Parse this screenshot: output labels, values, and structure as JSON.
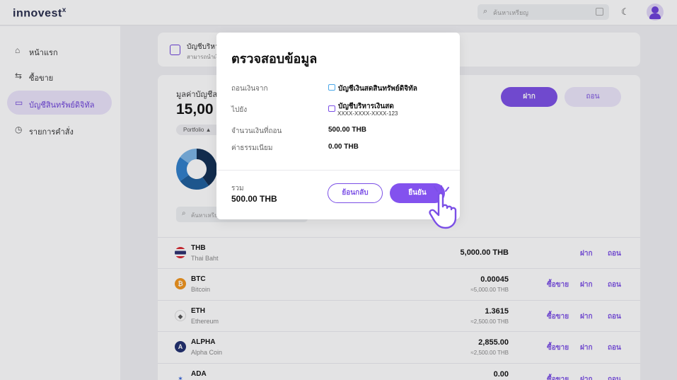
{
  "header": {
    "logo": "innovest",
    "logo_mark": "x",
    "search_placeholder": "ค้นหาเหรียญ"
  },
  "sidebar": {
    "items": [
      {
        "label": "หน้าแรก",
        "icon": "home-icon"
      },
      {
        "label": "ซื้อขาย",
        "icon": "swap-icon"
      },
      {
        "label": "บัญชีสินทรัพย์ดิจิทัล",
        "icon": "wallet-icon",
        "active": true
      },
      {
        "label": "รายการคำสั่ง",
        "icon": "history-icon"
      }
    ]
  },
  "account_card": {
    "title": "บัญชีบริหา",
    "subtitle": "สามารถนำเงิน"
  },
  "portfolio": {
    "label": "มูลค่าบัญชีส",
    "value": "15,00",
    "filter": "Portfolio ▲",
    "deposit_label": "ฝาก",
    "withdraw_label": "ถอน",
    "search_placeholder": "ค้นหาเหรีย",
    "donut": [
      {
        "color": "#0f2d52",
        "value": 40
      },
      {
        "color": "#1c5d9c",
        "value": 25
      },
      {
        "color": "#2f7fcb",
        "value": 20
      },
      {
        "color": "#7bb5e6",
        "value": 15
      }
    ]
  },
  "assets": [
    {
      "symbol": "THB",
      "name": "Thai Baht",
      "balance": "5,000.00 THB",
      "sub": "",
      "actions": [
        "ฝาก",
        "ถอน"
      ],
      "coin_color": "#ffffff",
      "coin_glyph": ""
    },
    {
      "symbol": "BTC",
      "name": "Bitcoin",
      "balance": "0.00045",
      "sub": "≈5,000.00 THB",
      "actions": [
        "ซื้อขาย",
        "ฝาก",
        "ถอน"
      ],
      "coin_color": "#f2951b",
      "coin_glyph": "₿"
    },
    {
      "symbol": "ETH",
      "name": "Ethereum",
      "balance": "1.3615",
      "sub": "≈2,500.00 THB",
      "actions": [
        "ซื้อขาย",
        "ฝาก",
        "ถอน"
      ],
      "coin_color": "#ffffff",
      "coin_glyph": "◆"
    },
    {
      "symbol": "ALPHA",
      "name": "Alpha Coin",
      "balance": "2,855.00",
      "sub": "≈2,500.00 THB",
      "actions": [
        "ซื้อขาย",
        "ฝาก",
        "ถอน"
      ],
      "coin_color": "#1e2d6e",
      "coin_glyph": "A"
    },
    {
      "symbol": "ADA",
      "name": "",
      "balance": "0.00",
      "sub": "",
      "actions": [
        "ซื้อขาย",
        "ฝาก",
        "ถอน"
      ],
      "coin_color": "#2a5bd7",
      "coin_glyph": "✶"
    }
  ],
  "modal": {
    "title": "ตรวจสอบข้อมูล",
    "from_label": "ถอนเงินจาก",
    "from_value": "บัญชีเงินสดสินทรัพย์ดิจิทัล",
    "to_label": "ไปยัง",
    "to_value": "บัญชีบริหารเงินสด",
    "to_account": "XXXX-XXXX-XXXX-123",
    "amount_label": "จำนวนเงินที่ถอน",
    "amount_value": "500.00 THB",
    "fee_label": "ค่าธรรมเนียม",
    "fee_value": "0.00 THB",
    "total_label": "รวม",
    "total_value": "500.00 THB",
    "back_label": "ย้อนกลับ",
    "confirm_label": "ยืนยัน"
  },
  "colors": {
    "accent": "#7b4fe6",
    "wallet_blue": "#4aa7e8"
  }
}
